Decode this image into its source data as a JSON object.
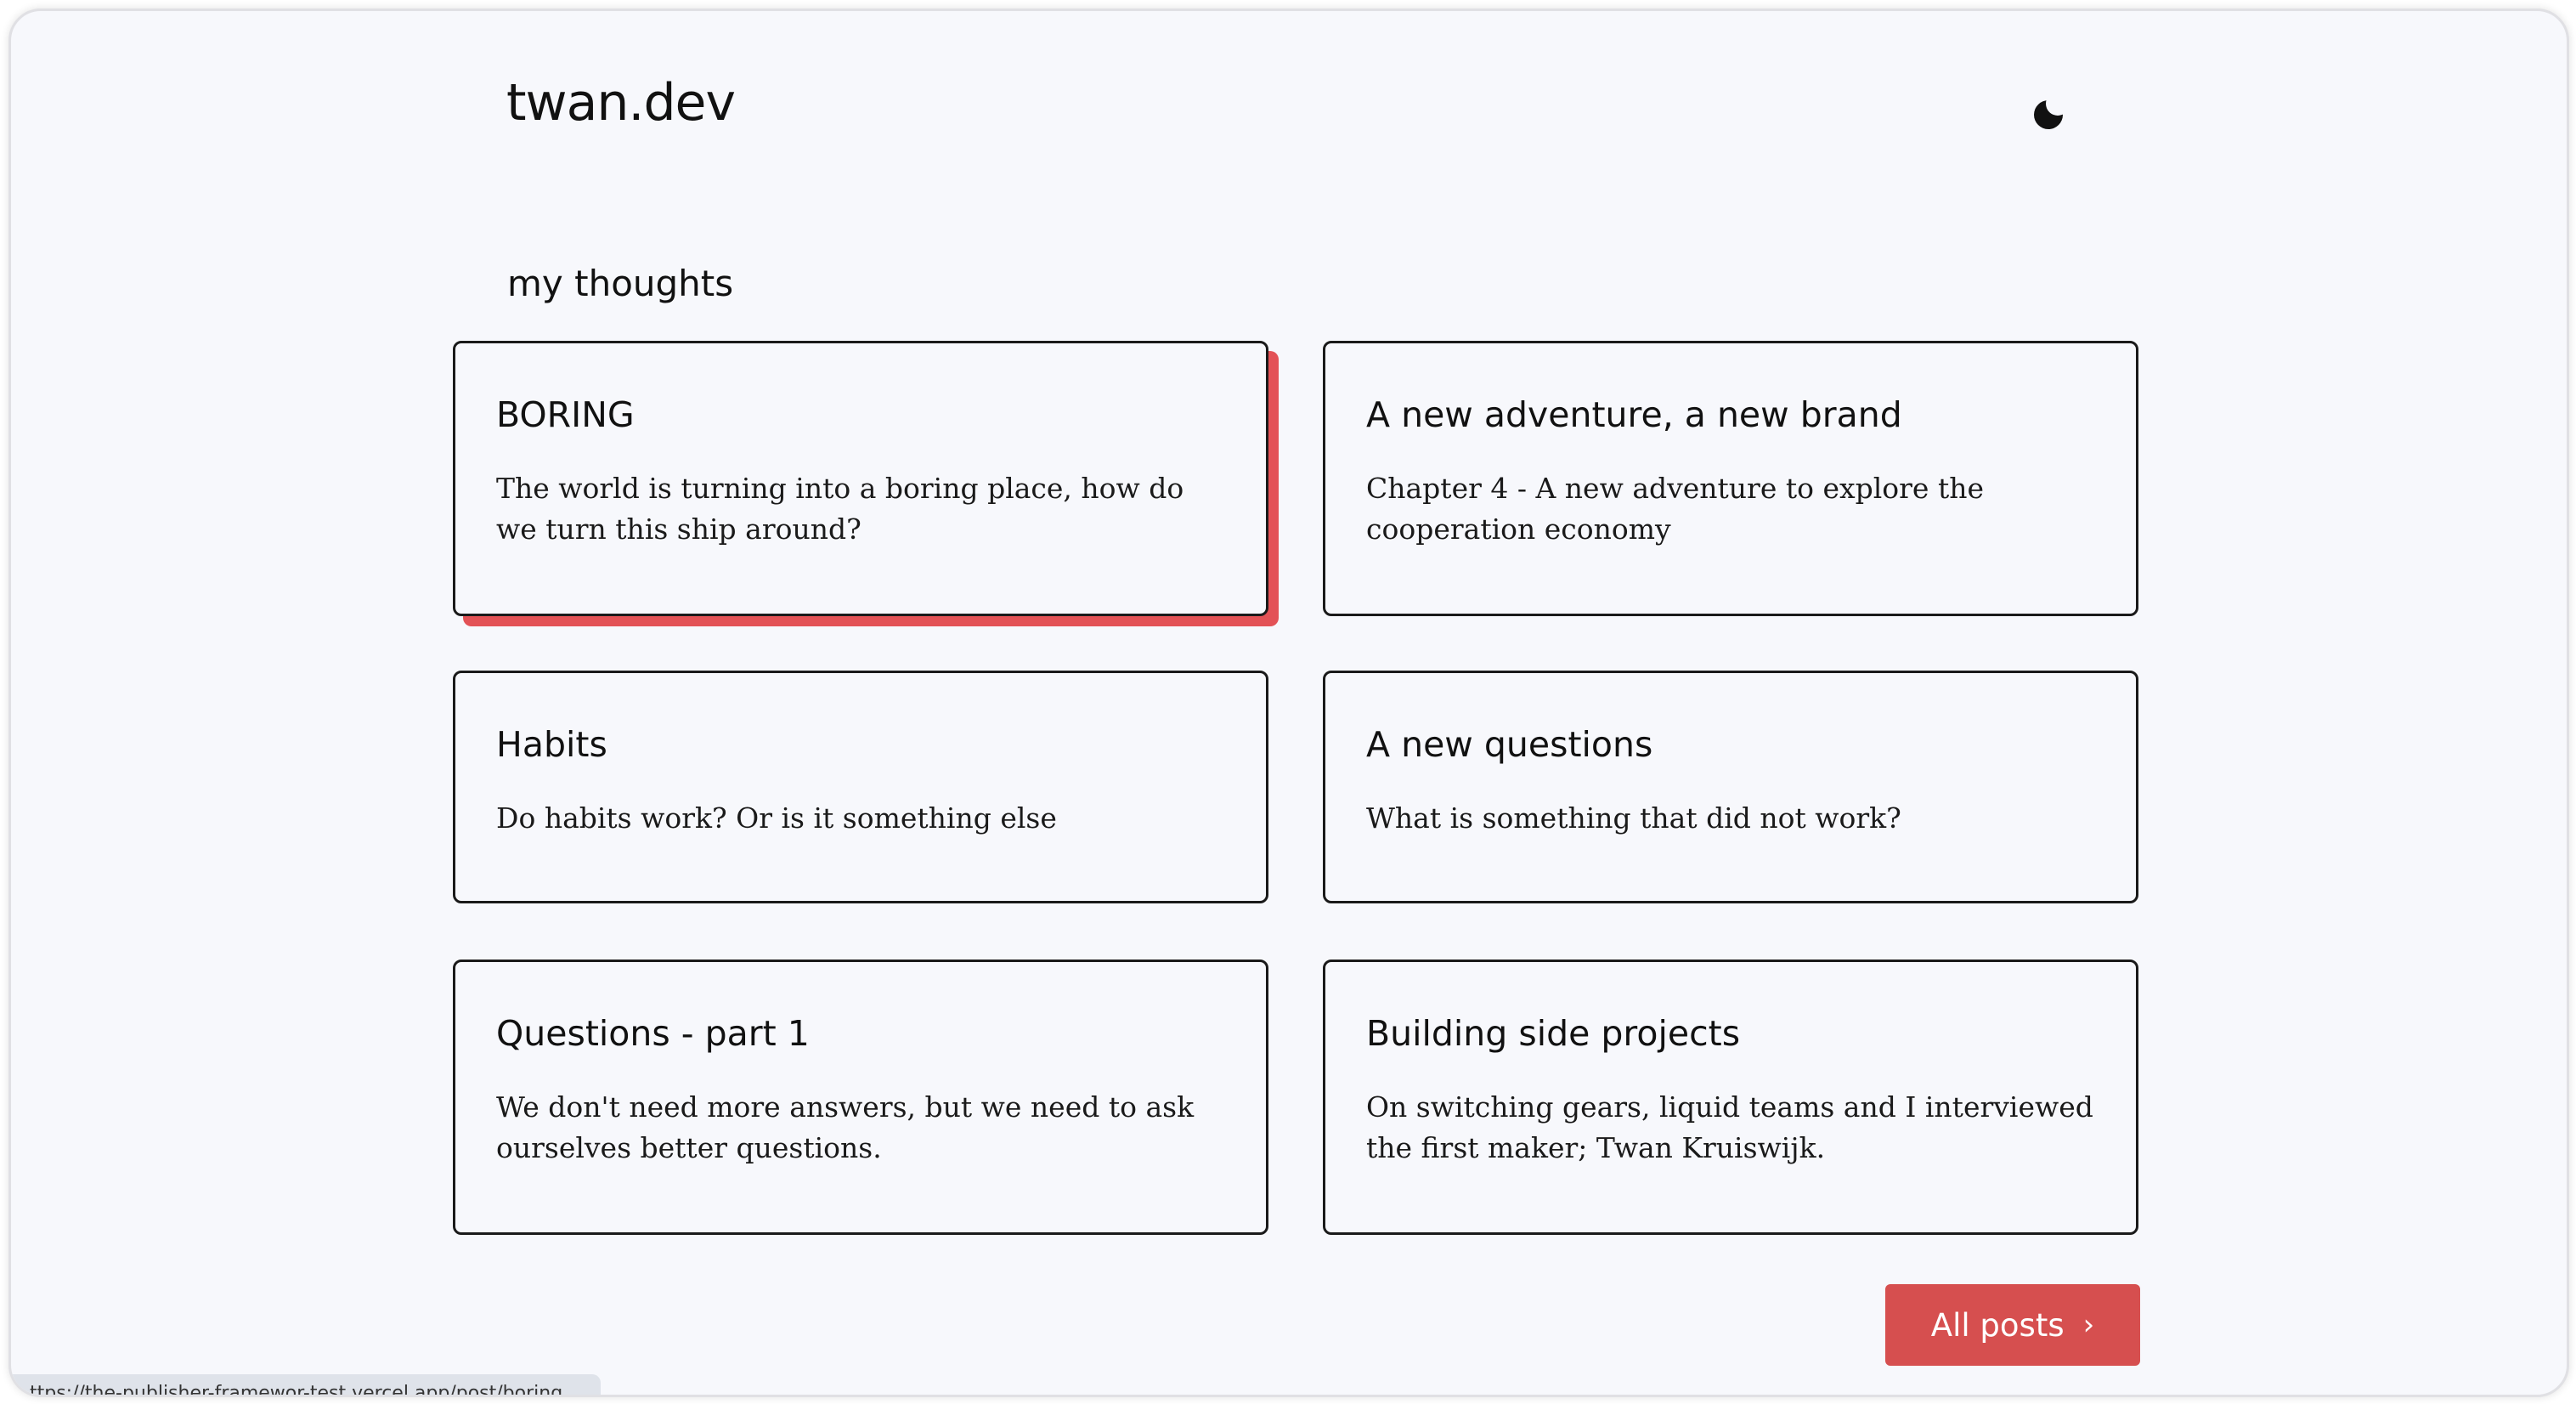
{
  "site": {
    "logo": "twan.dev",
    "theme_toggle_icon": "moon-icon"
  },
  "section": {
    "title": "my thoughts"
  },
  "posts": [
    {
      "title": "BORING",
      "description": "The world is turning into a boring place, how do we turn this ship around?"
    },
    {
      "title": "A new adventure, a new brand",
      "description": "Chapter 4 - A new adventure to explore the cooperation economy"
    },
    {
      "title": "Habits",
      "description": "Do habits work? Or is it something else"
    },
    {
      "title": "A new questions",
      "description": "What is something that did not work?"
    },
    {
      "title": "Questions - part 1",
      "description": "We don't need more answers, but we need to ask ourselves better questions."
    },
    {
      "title": "Building side projects",
      "description": "On switching gears, liquid teams and I interviewed the first maker; Twan Kruiswijk."
    }
  ],
  "all_posts": {
    "label": "All posts",
    "icon": "chevron-right-icon"
  },
  "status_bar": {
    "url": "ttps://the-publisher-framewor-test.vercel.app/post/boring"
  },
  "colors": {
    "accent": "#d64f4f",
    "active_shadow": "#e35256",
    "background": "#f7f8fc",
    "text": "#111111"
  }
}
